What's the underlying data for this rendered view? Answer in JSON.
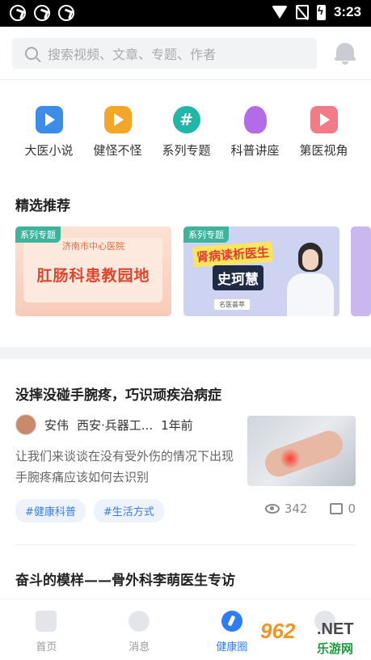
{
  "status_bar": {
    "time": "3:23"
  },
  "header": {
    "search_placeholder": "搜索视频、文章、专题、作者"
  },
  "categories": [
    {
      "label": "大医小说",
      "icon": "video-play-icon",
      "color": "#3c8dea"
    },
    {
      "label": "健怪不怪",
      "icon": "tv-play-icon",
      "color": "#f3a627"
    },
    {
      "label": "系列专题",
      "icon": "hashtag-icon",
      "color": "#22b6a9",
      "glyph": "#"
    },
    {
      "label": "科普讲座",
      "icon": "lightbulb-icon",
      "color": "#b36be8"
    },
    {
      "label": "第医视角",
      "icon": "screen-play-icon",
      "color": "#f07c88"
    }
  ],
  "featured": {
    "title": "精选推荐",
    "cards": [
      {
        "tag": "系列专题",
        "subtitle": "济南市中心医院",
        "title": "肛肠科患教园地"
      },
      {
        "tag": "系列专题",
        "title": "肾病读析医生",
        "name": "史珂慧",
        "footer": "名医荟萃"
      }
    ]
  },
  "articles": [
    {
      "title": "没摔没碰手腕疼，巧识顽疾治病症",
      "author": "安伟",
      "affiliation": "西安·兵器工...",
      "time": "1年前",
      "description": "让我们来谈谈在没有受外伤的情况下出现手腕疼痛应该如何去识别",
      "tags": [
        "#健康科普",
        "#生活方式"
      ],
      "views": "342",
      "comments": "0"
    },
    {
      "title": "奋斗的模样——骨外科李萌医生专访"
    }
  ],
  "bottom_nav": [
    {
      "label": "首页",
      "icon": "home-icon",
      "active": false
    },
    {
      "label": "消息",
      "icon": "message-icon",
      "active": false
    },
    {
      "label": "健康圈",
      "icon": "health-circle-icon",
      "active": true
    },
    {
      "label": "",
      "icon": "profile-icon",
      "active": false
    }
  ],
  "watermark": {
    "number": "962",
    "suffix": ".NET",
    "text": "乐游网"
  },
  "colors": {
    "accent": "#2f7cf6",
    "tag_bg": "#eef3fb",
    "tag_text": "#3a7de0",
    "badge": "#3fb39c"
  }
}
